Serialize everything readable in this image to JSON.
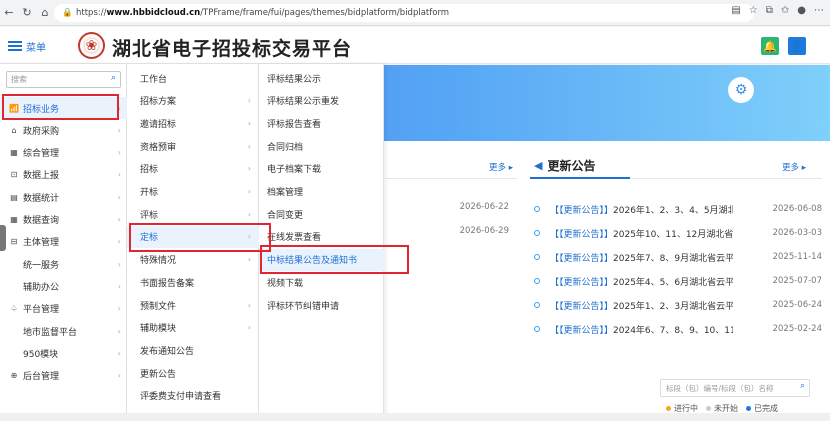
{
  "browser": {
    "url_prefix": "https://",
    "url_host": "www.hbbidcloud.cn",
    "url_path": "/TPFrame/frame/fui/pages/themes/bidplatform/bidplatform"
  },
  "header": {
    "menu_label": "菜单",
    "site_title": "湖北省电子招投标交易平台"
  },
  "sidebar": {
    "search_placeholder": "搜索",
    "items": [
      {
        "label": "招标业务",
        "icon": "chart-icon",
        "glyph": "📶",
        "has_icon": true
      },
      {
        "label": "政府采购",
        "icon": "building-icon",
        "glyph": "⌂",
        "has_icon": true
      },
      {
        "label": "综合管理",
        "icon": "grid-icon",
        "glyph": "▦",
        "has_icon": true
      },
      {
        "label": "数据上报",
        "icon": "upload-icon",
        "glyph": "⊡",
        "has_icon": true
      },
      {
        "label": "数据统计",
        "icon": "stats-icon",
        "glyph": "▤",
        "has_icon": true
      },
      {
        "label": "数据查询",
        "icon": "query-icon",
        "glyph": "▦",
        "has_icon": true
      },
      {
        "label": "主体管理",
        "icon": "entity-icon",
        "glyph": "⊟",
        "has_icon": true
      },
      {
        "label": "统一服务",
        "has_icon": false
      },
      {
        "label": "辅助办公",
        "has_icon": false
      },
      {
        "label": "平台管理",
        "icon": "platform-icon",
        "glyph": "♤",
        "has_icon": true
      },
      {
        "label": "地市监督平台",
        "has_icon": false
      },
      {
        "label": "950模块",
        "has_icon": false
      },
      {
        "label": "后台管理",
        "icon": "admin-icon",
        "glyph": "⊕",
        "has_icon": true
      }
    ]
  },
  "submenu": {
    "items": [
      {
        "label": "工作台",
        "arrow": false
      },
      {
        "label": "招标方案",
        "arrow": true
      },
      {
        "label": "邀请招标",
        "arrow": true
      },
      {
        "label": "资格预审",
        "arrow": true
      },
      {
        "label": "招标",
        "arrow": true
      },
      {
        "label": "开标",
        "arrow": true
      },
      {
        "label": "评标",
        "arrow": true
      },
      {
        "label": "定标",
        "arrow": true
      },
      {
        "label": "特殊情况",
        "arrow": true
      },
      {
        "label": "书面报告备案",
        "arrow": false
      },
      {
        "label": "预制文件",
        "arrow": true
      },
      {
        "label": "辅助模块",
        "arrow": true
      },
      {
        "label": "发布通知公告",
        "arrow": false
      },
      {
        "label": "更新公告",
        "arrow": false
      },
      {
        "label": "评委费支付申请查看",
        "arrow": false
      }
    ]
  },
  "submenu3": {
    "items": [
      {
        "label": "评标结果公示"
      },
      {
        "label": "评标结果公示重发"
      },
      {
        "label": "评标报告查看"
      },
      {
        "label": "合同归档"
      },
      {
        "label": "电子档案下载"
      },
      {
        "label": "档案管理"
      },
      {
        "label": "合同变更"
      },
      {
        "label": "在线发票查看"
      },
      {
        "label": "中标结果公告及通知书"
      },
      {
        "label": "视频下载"
      },
      {
        "label": "评标环节纠错申请"
      }
    ]
  },
  "left_panel": {
    "more_label": "更多 ▸",
    "dates": [
      "2026-06-22",
      "2026-06-29"
    ]
  },
  "news": {
    "title": "更新公告",
    "more_label": "更多 ▸",
    "rows": [
      {
        "tag": "【【更新公告】】",
        "text": "2026年1、2、3、4、5月湖北",
        "date": "2026-06-08"
      },
      {
        "tag": "【【更新公告】】",
        "text": "2025年10、11、12月湖北省云",
        "date": "2026-03-03"
      },
      {
        "tag": "【【更新公告】】",
        "text": "2025年7、8、9月湖北省云平台",
        "date": "2025-11-14"
      },
      {
        "tag": "【【更新公告】】",
        "text": "2025年4、5、6月湖北省云平台",
        "date": "2025-07-07"
      },
      {
        "tag": "【【更新公告】】",
        "text": "2025年1、2、3月湖北省云平台",
        "date": "2025-06-24"
      },
      {
        "tag": "【【更新公告】】",
        "text": "2024年6、7、8、9、10、11、",
        "date": "2025-02-24"
      }
    ]
  },
  "project_search": {
    "placeholder": "标段（包）编号/标段（包）名称"
  },
  "legend": [
    {
      "label": "进行中",
      "color": "#f5a623"
    },
    {
      "label": "未开始",
      "color": "#cccccc"
    },
    {
      "label": "已完成",
      "color": "#1f7ae0"
    }
  ]
}
